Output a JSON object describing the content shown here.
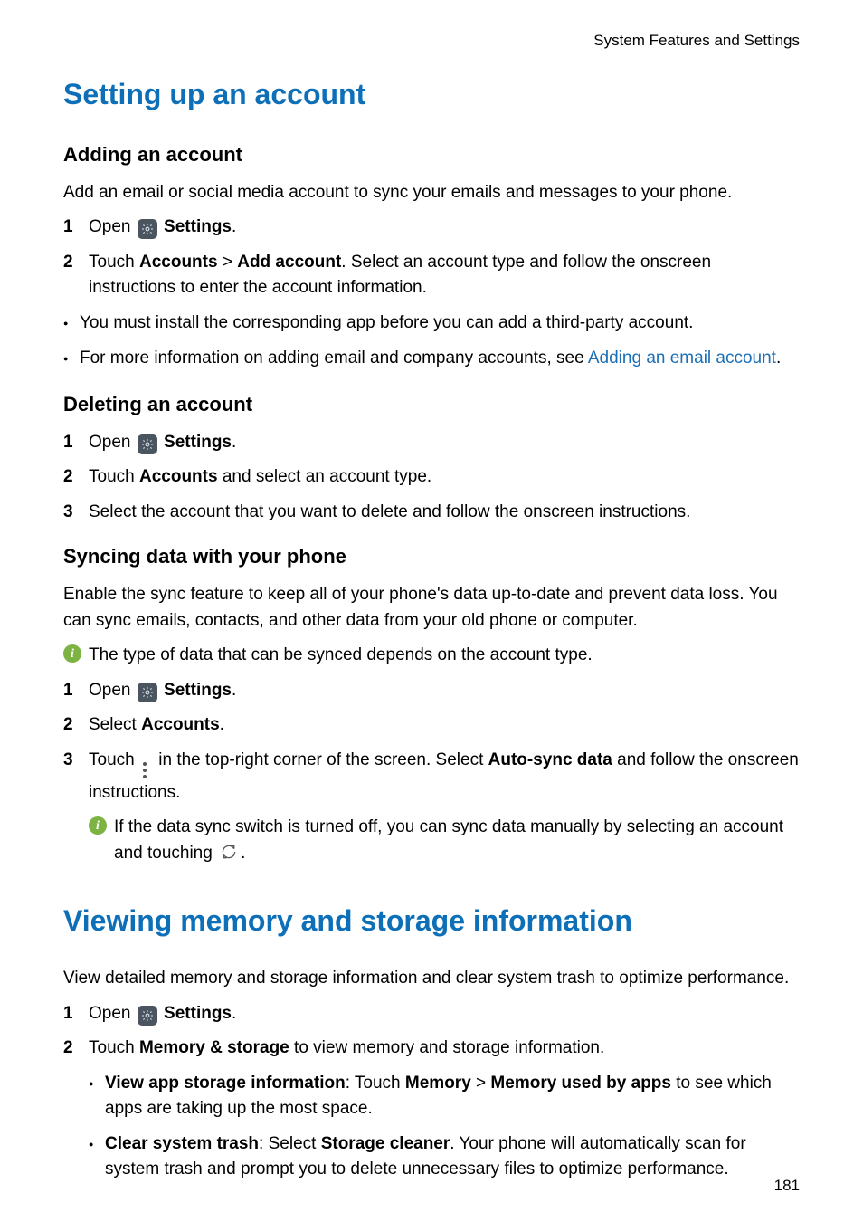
{
  "header": {
    "breadcrumb": "System Features and Settings"
  },
  "section1": {
    "title": "Setting up an account",
    "sub1": {
      "heading": "Adding an account",
      "intro": "Add an email or social media account to sync your emails and messages to your phone.",
      "step1_a": "Open ",
      "step1_b": "Settings",
      "step1_c": ".",
      "step2_a": "Touch ",
      "step2_b": "Accounts",
      "step2_c": " > ",
      "step2_d": "Add account",
      "step2_e": ". Select an account type and follow the onscreen instructions to enter the account information.",
      "bul1": "You must install the corresponding app before you can add a third-party account.",
      "bul2_a": "For more information on adding email and company accounts, see ",
      "bul2_link": "Adding an email account",
      "bul2_c": "."
    },
    "sub2": {
      "heading": "Deleting an account",
      "step1_a": "Open ",
      "step1_b": "Settings",
      "step1_c": ".",
      "step2_a": "Touch ",
      "step2_b": "Accounts",
      "step2_c": " and select an account type.",
      "step3": "Select the account that you want to delete and follow the onscreen instructions."
    },
    "sub3": {
      "heading": "Syncing data with your phone",
      "intro": "Enable the sync feature to keep all of your phone's data up-to-date and prevent data loss. You can sync emails, contacts, and other data from your old phone or computer.",
      "info1": "The type of data that can be synced depends on the account type.",
      "step1_a": "Open ",
      "step1_b": "Settings",
      "step1_c": ".",
      "step2_a": "Select ",
      "step2_b": "Accounts",
      "step2_c": ".",
      "step3_a": "Touch ",
      "step3_b": " in the top-right corner of the screen. Select ",
      "step3_c": "Auto-sync data",
      "step3_d": " and follow the onscreen instructions.",
      "info2_a": "If the data sync switch is turned off, you can sync data manually by selecting an account and touching ",
      "info2_b": "."
    }
  },
  "section2": {
    "title": "Viewing memory and storage information",
    "intro": "View detailed memory and storage information and clear system trash to optimize performance.",
    "step1_a": "Open ",
    "step1_b": "Settings",
    "step1_c": ".",
    "step2_a": "Touch ",
    "step2_b": "Memory & storage",
    "step2_c": " to view memory and storage information.",
    "sb1_a": "View app storage information",
    "sb1_b": ": Touch ",
    "sb1_c": "Memory",
    "sb1_d": " > ",
    "sb1_e": "Memory used by apps",
    "sb1_f": " to see which apps are taking up the most space.",
    "sb2_a": "Clear system trash",
    "sb2_b": ": Select ",
    "sb2_c": "Storage cleaner",
    "sb2_d": ". Your phone will automatically scan for system trash and prompt you to delete unnecessary files to optimize performance."
  },
  "page_number": "181",
  "nums": {
    "n1": "1",
    "n2": "2",
    "n3": "3"
  }
}
